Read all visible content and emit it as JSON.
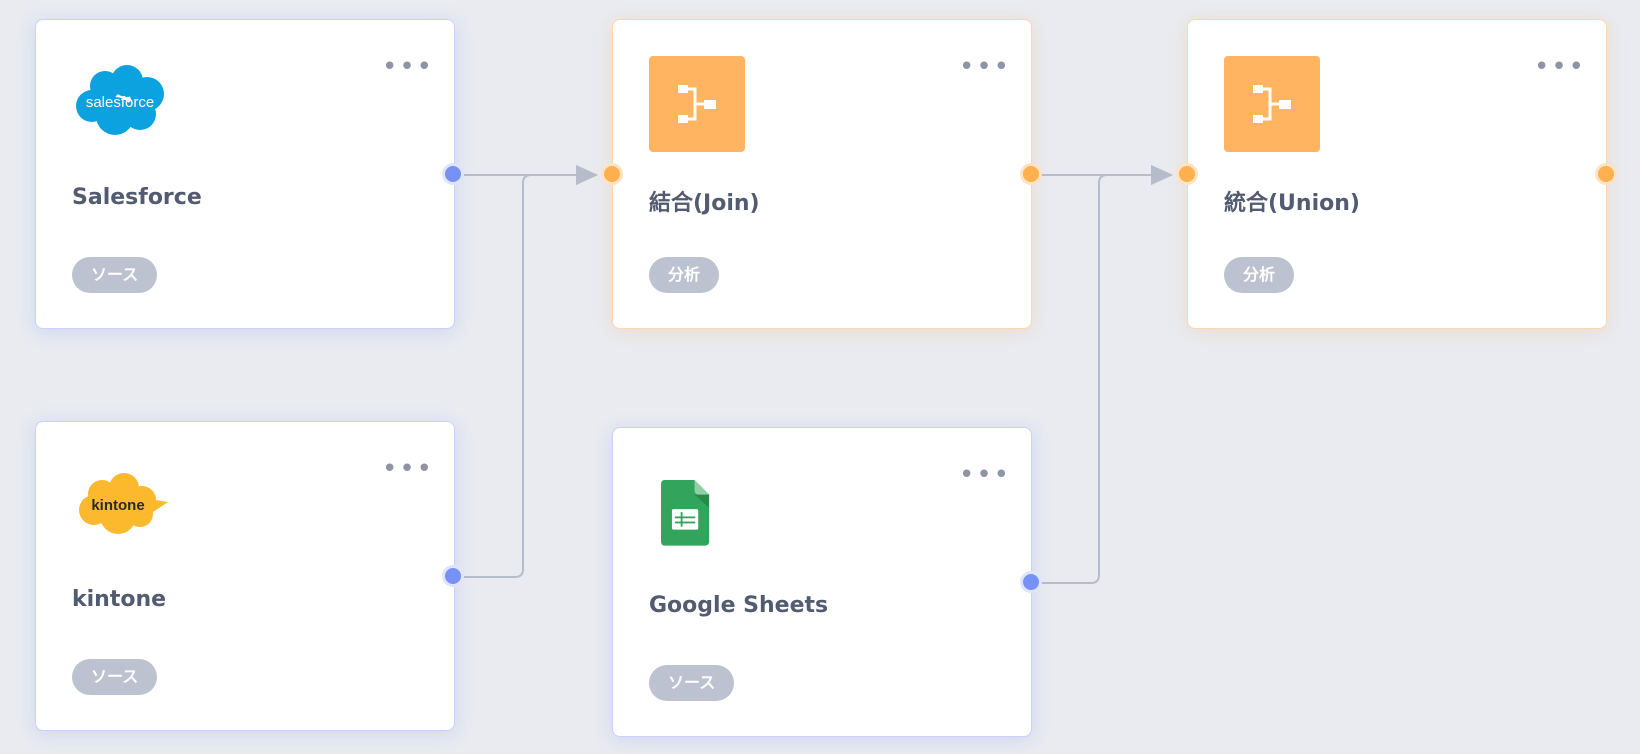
{
  "nodes": {
    "salesforce": {
      "logo_text": "salesforce",
      "title": "Salesforce",
      "badge": "ソース",
      "menu": "•••"
    },
    "kintone": {
      "logo_text": "kintone",
      "title": "kintone",
      "badge": "ソース",
      "menu": "•••"
    },
    "join": {
      "title": "結合(Join)",
      "badge": "分析",
      "menu": "•••"
    },
    "google_sheets": {
      "title": "Google Sheets",
      "badge": "ソース",
      "menu": "•••"
    },
    "union": {
      "title": "統合(Union)",
      "badge": "分析",
      "menu": "•••"
    }
  },
  "colors": {
    "source_port": "#7891f4",
    "analysis_port": "#ffb04f",
    "edge": "#b7bccb",
    "badge": "#bcc2cf",
    "title_text": "#525b70",
    "salesforce_blue": "#0ca2e0",
    "kintone_yellow": "#fcb92d",
    "sheets_green": "#33a45b"
  },
  "icons": {
    "join": "flow-branch-icon",
    "union": "flow-branch-icon",
    "salesforce": "salesforce-cloud-logo",
    "kintone": "kintone-cloud-logo",
    "google_sheets": "google-sheets-icon"
  }
}
